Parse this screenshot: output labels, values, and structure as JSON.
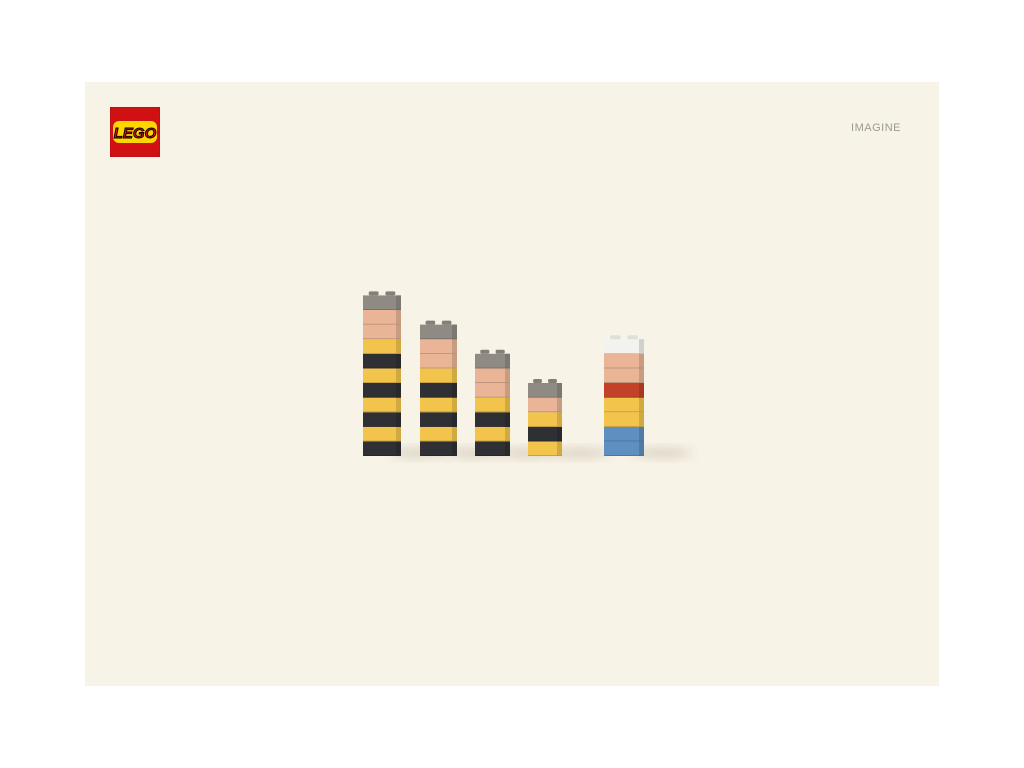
{
  "brand": {
    "logo_text": "LEGO"
  },
  "tagline": "IMAGINE",
  "colors": {
    "background": "#f8f3e7",
    "logo_red": "#d01012",
    "logo_yellow": "#ffd500",
    "brick_gray": "#8f8a84",
    "skin": "#e9b596",
    "yellow": "#f2c44c",
    "black": "#2e3033",
    "white": "#f2f2ef",
    "red": "#c24128",
    "blue": "#5f8ec0"
  },
  "figures": [
    {
      "name": "tall-striped",
      "bricks": [
        "black",
        "yellow",
        "black",
        "yellow",
        "black",
        "yellow",
        "black",
        "yellow",
        "skin",
        "skin",
        "gray"
      ]
    },
    {
      "name": "second-striped",
      "bricks": [
        "black",
        "yellow",
        "black",
        "yellow",
        "black",
        "yellow",
        "skin",
        "skin",
        "gray"
      ]
    },
    {
      "name": "third-striped",
      "bricks": [
        "black",
        "yellow",
        "black",
        "yellow",
        "skin",
        "skin",
        "gray"
      ]
    },
    {
      "name": "short-striped",
      "bricks": [
        "yellow",
        "black",
        "yellow",
        "skin",
        "gray"
      ]
    },
    {
      "name": "blue-red-figure",
      "bricks": [
        "blue",
        "blue",
        "yellow",
        "yellow",
        "red",
        "skin",
        "skin",
        "white"
      ]
    }
  ]
}
